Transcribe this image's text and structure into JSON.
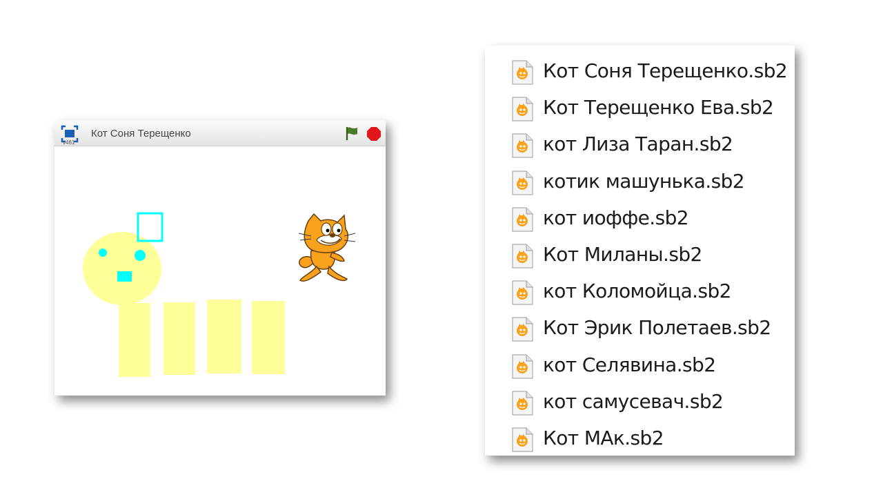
{
  "player": {
    "version": "v461",
    "title": "Кот Соня Терещенко",
    "icons": {
      "fullscreen": "fullscreen-icon",
      "flag": "green-flag-icon",
      "stop": "stop-icon"
    },
    "colors": {
      "flag": "#4c7a2a",
      "stop": "#e0161c",
      "fullscreen": "#1b5fb5",
      "drawing_fill": "#ffff99",
      "drawing_accent": "#00ffff"
    }
  },
  "file_list": {
    "icon": "scratch-file-icon",
    "files": [
      "Кот Соня Терещенко.sb2",
      "Кот Терещенко Ева.sb2",
      "кот Лиза Таран.sb2",
      "котик машунька.sb2",
      "кот иоффе.sb2",
      "Кот Миланы.sb2",
      "кот Коломойца.sb2",
      "Кот Эрик Полетаев.sb2",
      "кот Селявина.sb2",
      "кот самусевач.sb2",
      "Кот МАк.sb2"
    ]
  }
}
